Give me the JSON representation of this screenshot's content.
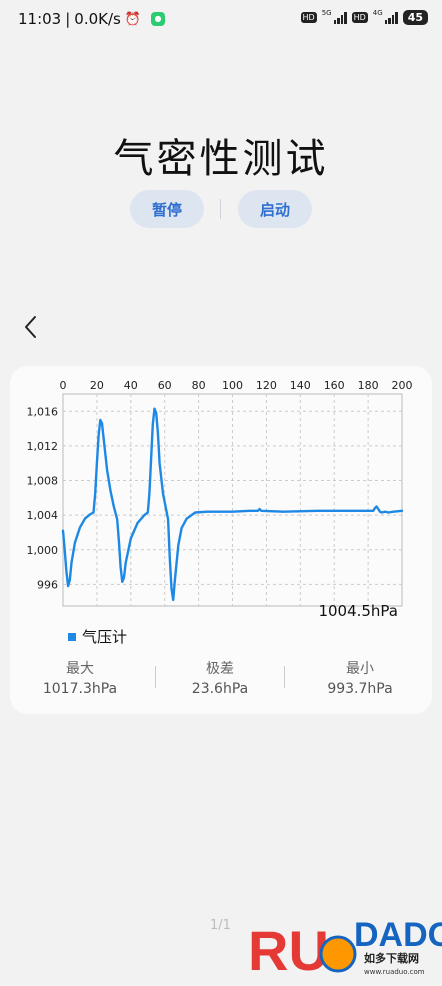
{
  "status_bar": {
    "time": "11:03",
    "speed": "0.0K/s",
    "battery": "45",
    "hd": "HD",
    "net1": "5G",
    "net2": "4G",
    "icons": [
      "alarm-icon",
      "app-badge-icon",
      "signal-icon",
      "battery-icon"
    ]
  },
  "page": {
    "title": "气密性测试",
    "pause_label": "暂停",
    "start_label": "启动",
    "page_indicator": "1/1"
  },
  "chart_data": {
    "type": "line",
    "x_ticks": [
      0,
      20,
      40,
      60,
      80,
      100,
      120,
      140,
      160,
      180,
      200
    ],
    "y_ticks": [
      996,
      1000,
      1004,
      1008,
      1012,
      1016
    ],
    "y_tick_labels": [
      "996",
      "1,000",
      "1,004",
      "1,008",
      "1,012",
      "1,016"
    ],
    "xlim": [
      0,
      200
    ],
    "ylim": [
      993.5,
      1018
    ],
    "grid": true,
    "x_axis_position": "top",
    "series": [
      {
        "name": "气压计",
        "color": "#1e88e5",
        "points": [
          [
            0,
            1002.2
          ],
          [
            1,
            1000
          ],
          [
            2,
            997.5
          ],
          [
            3,
            995.8
          ],
          [
            4,
            996.5
          ],
          [
            5,
            998.5
          ],
          [
            7,
            1000.8
          ],
          [
            10,
            1002.6
          ],
          [
            13,
            1003.6
          ],
          [
            16,
            1004.1
          ],
          [
            18,
            1004.3
          ],
          [
            19,
            1006.5
          ],
          [
            20,
            1010
          ],
          [
            21,
            1013.2
          ],
          [
            22,
            1015
          ],
          [
            23,
            1014.6
          ],
          [
            24,
            1012.8
          ],
          [
            26,
            1009.2
          ],
          [
            28,
            1006.8
          ],
          [
            30,
            1005
          ],
          [
            32,
            1003.5
          ],
          [
            33,
            1001
          ],
          [
            34,
            998
          ],
          [
            35,
            996.3
          ],
          [
            36,
            996.8
          ],
          [
            37,
            998.5
          ],
          [
            40,
            1001.3
          ],
          [
            44,
            1003.1
          ],
          [
            48,
            1004
          ],
          [
            50,
            1004.3
          ],
          [
            51,
            1006.5
          ],
          [
            52,
            1010.5
          ],
          [
            53,
            1014.5
          ],
          [
            54,
            1016.3
          ],
          [
            55,
            1015.8
          ],
          [
            56,
            1013.5
          ],
          [
            57,
            1010
          ],
          [
            59,
            1006.5
          ],
          [
            61,
            1004.5
          ],
          [
            62,
            1003.5
          ],
          [
            63,
            999
          ],
          [
            64,
            995.5
          ],
          [
            65,
            994.2
          ],
          [
            66,
            996.5
          ],
          [
            68,
            1000.5
          ],
          [
            70,
            1002.5
          ],
          [
            73,
            1003.6
          ],
          [
            78,
            1004.3
          ],
          [
            85,
            1004.4
          ],
          [
            100,
            1004.4
          ],
          [
            110,
            1004.5
          ],
          [
            115,
            1004.5
          ],
          [
            116,
            1004.7
          ],
          [
            117,
            1004.5
          ],
          [
            130,
            1004.4
          ],
          [
            150,
            1004.5
          ],
          [
            170,
            1004.5
          ],
          [
            183,
            1004.5
          ],
          [
            184,
            1004.8
          ],
          [
            185,
            1005
          ],
          [
            186,
            1004.7
          ],
          [
            187,
            1004.4
          ],
          [
            188,
            1004.3
          ],
          [
            190,
            1004.4
          ],
          [
            192,
            1004.3
          ],
          [
            195,
            1004.4
          ],
          [
            200,
            1004.5
          ]
        ]
      }
    ],
    "current_value": "1004.5hPa"
  },
  "stats": [
    {
      "label": "最大",
      "value": "1017.3hPa"
    },
    {
      "label": "极差",
      "value": "23.6hPa"
    },
    {
      "label": "最小",
      "value": "993.7hPa"
    }
  ]
}
